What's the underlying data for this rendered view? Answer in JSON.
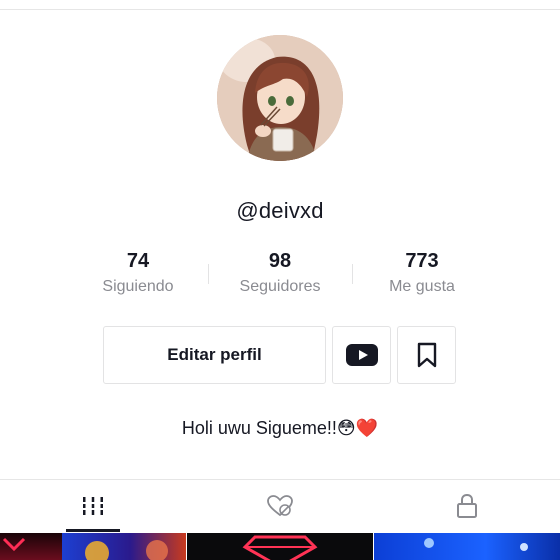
{
  "profile": {
    "username": "@deivxd",
    "avatar_icon": "anime-girl-avatar"
  },
  "stats": [
    {
      "value": "74",
      "label": "Siguiendo"
    },
    {
      "value": "98",
      "label": "Seguidores"
    },
    {
      "value": "773",
      "label": "Me gusta"
    }
  ],
  "actions": {
    "edit_label": "Editar perfil",
    "youtube_icon": "youtube-icon",
    "bookmark_icon": "bookmark-icon"
  },
  "bio": "Holi uwu Sigueme!!😳❤️",
  "tabs": [
    {
      "icon": "videos-grid-icon",
      "active": true
    },
    {
      "icon": "liked-heart-icon",
      "active": false
    },
    {
      "icon": "lock-icon",
      "active": false
    }
  ],
  "colors": {
    "text": "#161823",
    "secondary": "#8a8b91",
    "border": "#e3e3e4"
  }
}
